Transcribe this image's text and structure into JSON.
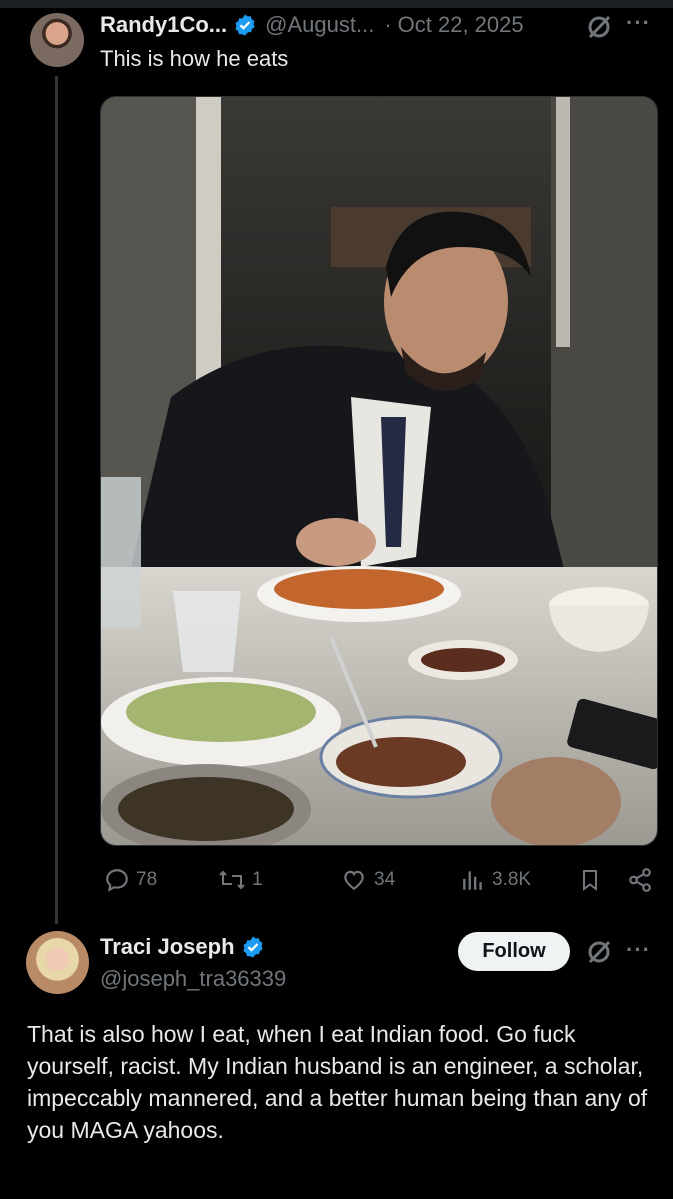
{
  "original_post": {
    "author_name": "Randy1Co...",
    "handle": "@August...",
    "separator": "·",
    "date": "Oct 22, 2025",
    "text": "This is how he eats",
    "more": "···",
    "stats": {
      "replies": "78",
      "reposts": "1",
      "likes": "34",
      "views": "3.8K"
    }
  },
  "reply": {
    "author_name": "Traci Joseph",
    "handle": "@joseph_tra36339",
    "follow_label": "Follow",
    "more": "···",
    "text": "That is also how I eat, when I eat Indian food. Go fuck yourself, racist. My Indian husband is an engineer, a scholar, impeccably mannered, and a better human being than any of you MAGA yahoos."
  },
  "colors": {
    "background": "#000000",
    "text": "#e7e9ea",
    "muted": "#71767b",
    "verified": "#1d9bf0"
  },
  "icons": [
    "verified-badge-icon",
    "grok-icon",
    "more-icon",
    "reply-icon",
    "repost-icon",
    "like-icon",
    "views-icon",
    "bookmark-icon",
    "share-icon"
  ]
}
